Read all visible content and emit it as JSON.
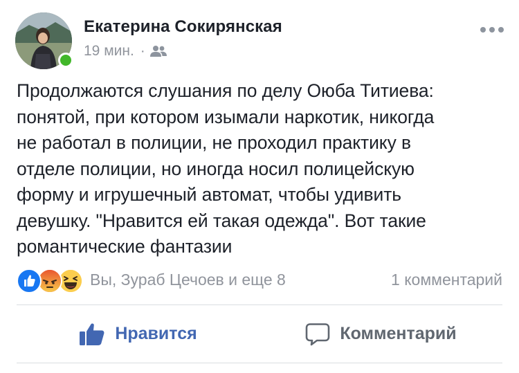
{
  "post": {
    "author": "Екатерина Сокирянская",
    "time": "19 мин.",
    "separator": "·",
    "privacy_icon": "friends-icon",
    "more_icon": "more-icon",
    "text": "Продолжаются слушания по делу Оюба Титиева:\nпонятой, при котором изымали наркотик, никогда\nне работал в полиции, не проходил практику в\nотделе полиции, но иногда носил полицейскую\nформу и игрушечный автомат, чтобы удивить\nдевушку. \"Нравится ей такая одежда\". Вот такие\nромантические фантазии"
  },
  "reactions": {
    "icons": [
      "like-reaction-icon",
      "angry-reaction-icon",
      "haha-reaction-icon"
    ],
    "summary": "Вы, Зураб Цечоев и еще 8",
    "comments": "1 комментарий"
  },
  "actions": {
    "like_label": "Нравится",
    "comment_label": "Комментарий"
  },
  "colors": {
    "accent": "#4267b2",
    "online": "#42b72a",
    "muted": "#90949c",
    "like_reaction": "#1877f2",
    "angry_reaction": "#f0643c",
    "haha_reaction": "#fbcd4e"
  }
}
